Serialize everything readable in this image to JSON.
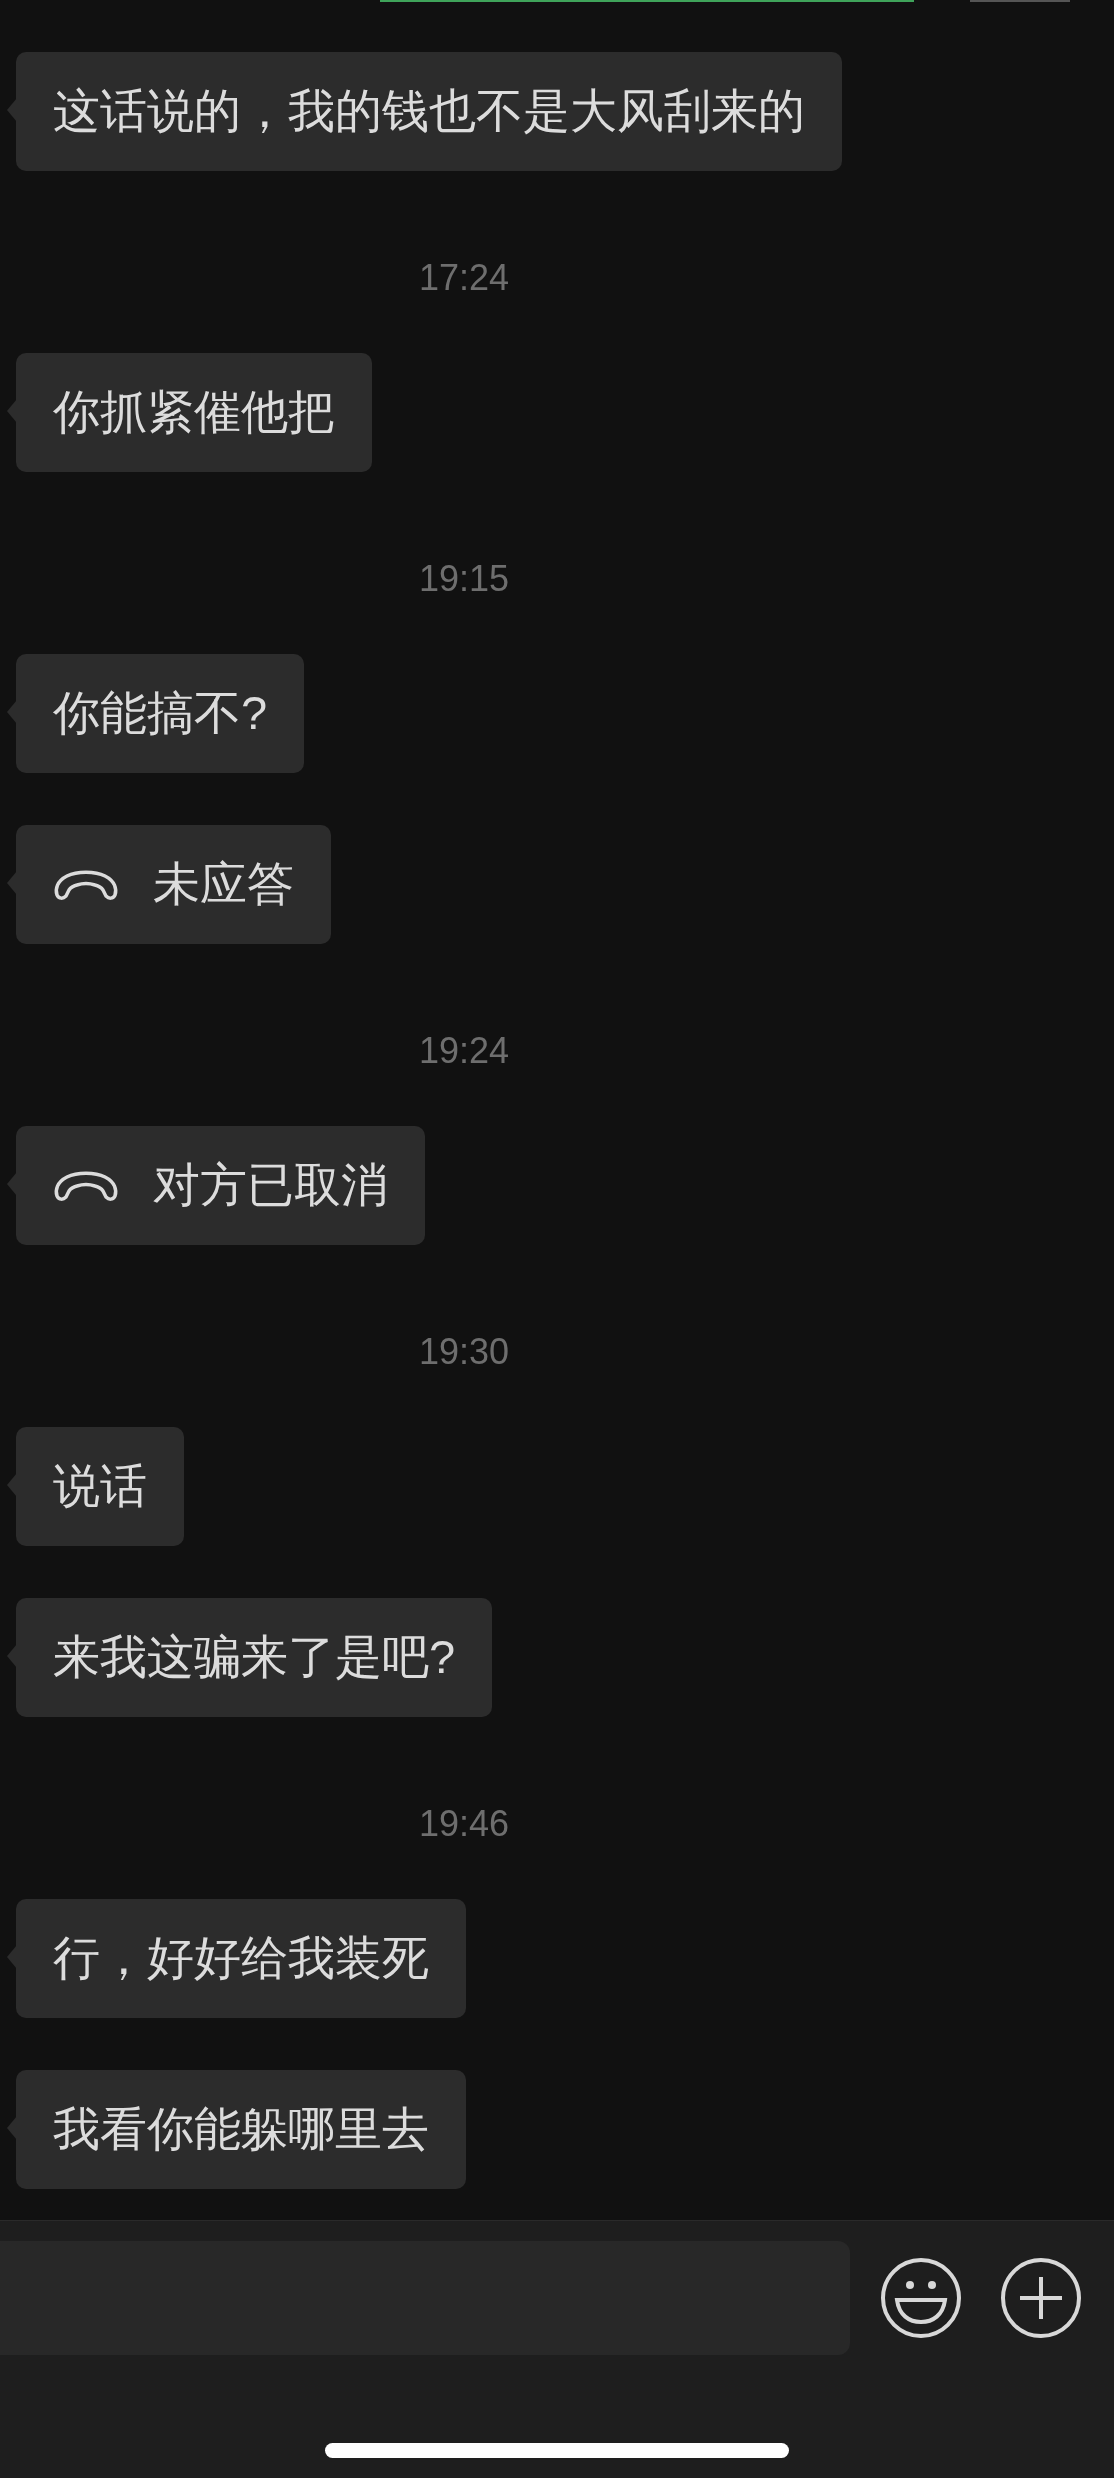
{
  "messages": [
    {
      "kind": "text",
      "text": "这话说的，我的钱也不是大风刮来的"
    },
    {
      "kind": "time",
      "text": "17:24"
    },
    {
      "kind": "text",
      "text": "你抓紧催他把"
    },
    {
      "kind": "time",
      "text": "19:15"
    },
    {
      "kind": "text",
      "text": "你能搞不?"
    },
    {
      "kind": "call",
      "text": "未应答"
    },
    {
      "kind": "time",
      "text": "19:24"
    },
    {
      "kind": "call",
      "text": "对方已取消"
    },
    {
      "kind": "time",
      "text": "19:30"
    },
    {
      "kind": "text",
      "text": "说话"
    },
    {
      "kind": "text",
      "text": "来我这骗来了是吧?"
    },
    {
      "kind": "time",
      "text": "19:46"
    },
    {
      "kind": "text",
      "text": "行，好好给我装死"
    },
    {
      "kind": "text",
      "text": "我看你能躲哪里去"
    }
  ]
}
